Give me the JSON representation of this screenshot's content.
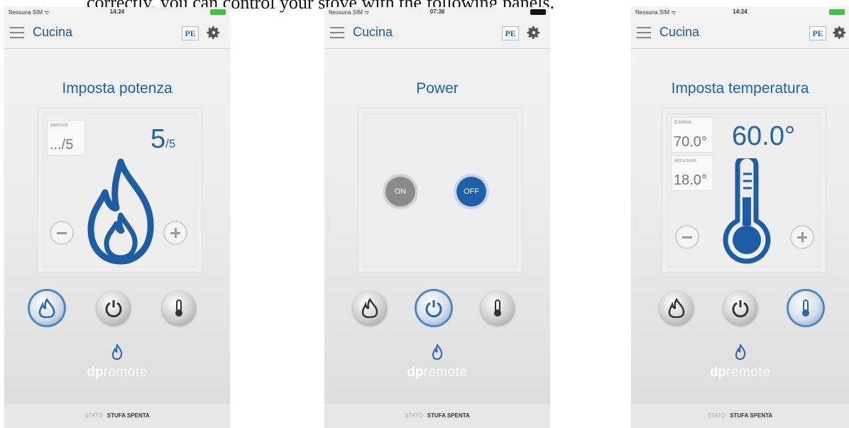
{
  "caption": "correctly, you can control your stove with the following panels.",
  "phones": [
    {
      "status": {
        "carrier": "Nessuna SIM ᯤ",
        "time": "14:24"
      },
      "room": "Cucina",
      "pe_label": "PE",
      "title": "Imposta potenza",
      "mini_label": "potenza",
      "mini_value": ".../5",
      "big_value": "5",
      "big_suffix": "/5",
      "footer_key": "STATO",
      "footer_value": "STUFA SPENTA",
      "logo_bold": "dp",
      "logo_light": "remote"
    },
    {
      "status": {
        "carrier": "Nessuna SIM ᯤ",
        "time": "07:38"
      },
      "room": "",
      "pe_label": "PE",
      "title": "Power",
      "on_label": "ON",
      "off_label": "OFF",
      "footer_key": "STATO",
      "footer_value": "STUFA SPENTA",
      "logo_bold": "dp",
      "logo_light": "remote"
    },
    {
      "status": {
        "carrier": "Nessuna SIM ᯤ",
        "time": "14:24"
      },
      "room": "Cucina",
      "pe_label": "PE",
      "title": "Imposta temperatura",
      "mini1_label": "Caldaia",
      "mini1_value": "70.0°",
      "mini2_label": "Accumulo",
      "mini2_value": "18.0°",
      "big_value": "60.0°",
      "footer_key": "STATO",
      "footer_value": "STUFA SPENTA",
      "logo_bold": "dp",
      "logo_light": "remote"
    }
  ],
  "colors": {
    "accent": "#1f5fa6",
    "title": "#2061a8",
    "battery_green": "#3cc43c"
  }
}
